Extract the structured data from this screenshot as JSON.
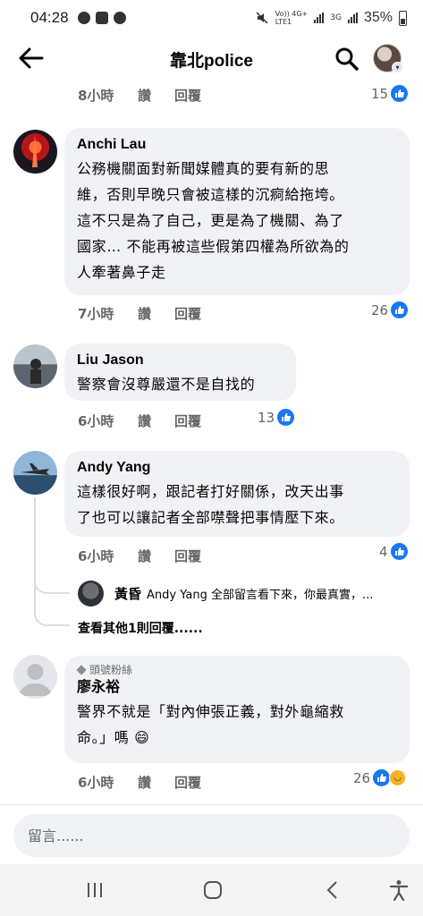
{
  "status_bar": {
    "time": "04:28",
    "net_label_top": "Vo)) 4G+",
    "net_label_bottom": "LTE1",
    "net2": "3G",
    "battery": "35%"
  },
  "header": {
    "title": "靠北police"
  },
  "first_meta": {
    "time": "8小時",
    "like": "讚",
    "reply": "回覆",
    "count": "15"
  },
  "comments": [
    {
      "author": "Anchi Lau",
      "lines": [
        "公務機關面對新聞媒體真的要有新的思",
        "維，否則早晚只會被這樣的沉痾給拖垮。",
        "這不只是為了自己，更是為了機關、為了",
        "國家… 不能再被這些假第四權為所欲為的",
        "人牽著鼻子走"
      ],
      "time": "7小時",
      "like": "讚",
      "reply": "回覆",
      "count": "26"
    },
    {
      "author": "Liu Jason",
      "lines": [
        "警察會沒尊嚴還不是自找的"
      ],
      "time": "6小時",
      "like": "讚",
      "reply": "回覆",
      "count": "13"
    },
    {
      "author": "Andy Yang",
      "lines": [
        "這樣很好啊，跟記者打好關係，改天出事",
        "了也可以讓記者全部噤聲把事情壓下來。"
      ],
      "time": "6小時",
      "like": "讚",
      "reply": "回覆",
      "count": "4",
      "reply_preview": {
        "author": "黃昏",
        "text": "Andy Yang 全部留言看下來，你最真實，..."
      },
      "more_replies": "查看其他1則回覆......"
    },
    {
      "badge": "頭號粉絲",
      "author": "廖永裕",
      "lines": [
        "警界不就是「對內伸張正義，對外龜縮救",
        "命。」嗎 😄"
      ],
      "time": "6小時",
      "like": "讚",
      "reply": "回覆",
      "count": "26"
    }
  ],
  "composer": {
    "placeholder": "留言......"
  },
  "colors": {
    "bubble": "#f0f2f5",
    "meta_text": "#65676b",
    "like_blue": "#1877f2",
    "haha_yellow": "#f7b125"
  }
}
